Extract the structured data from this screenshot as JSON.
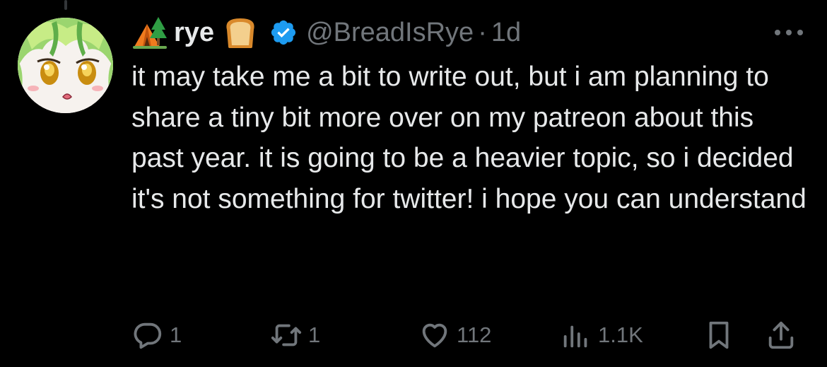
{
  "tweet": {
    "display_name": "rye",
    "handle": "@BreadIsRye",
    "separator": "·",
    "time": "1d",
    "text": "it may take me a bit to write out, but i am planning to share a tiny bit more over on my patreon about this past year. it is going to be a heavier topic, so i decided it's not something for twitter! i hope you can understand",
    "name_emojis": [
      "camping-tent-icon",
      "bread-icon"
    ],
    "verified": true
  },
  "actions": {
    "reply_count": "1",
    "retweet_count": "1",
    "like_count": "112",
    "views_count": "1.1K"
  },
  "colors": {
    "background": "#000000",
    "text_primary": "#e7e9ea",
    "text_secondary": "#71767b",
    "verified_blue": "#1d9bf0",
    "avatar_hair": "#8fd46a"
  }
}
